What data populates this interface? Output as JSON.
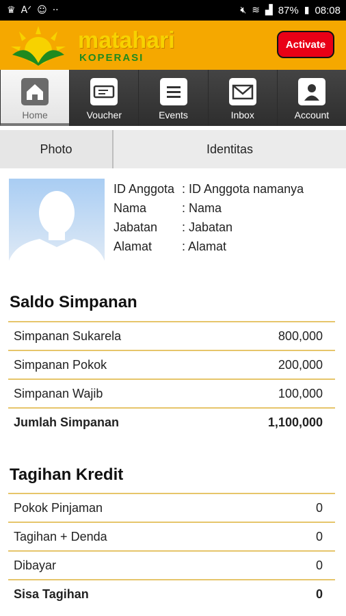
{
  "status_bar": {
    "battery": "87%",
    "time": "08:08",
    "left_icons": [
      "crown-icon",
      "font-icon",
      "cat-icon",
      "more-dots-icon"
    ],
    "right_icons": [
      "mute-icon",
      "wifi-icon",
      "signal-icon",
      "battery-icon"
    ]
  },
  "header": {
    "logo_title": "matahari",
    "logo_subtitle": "KOPERASI",
    "activate_label": "Activate",
    "colors": {
      "header_bg": "#f5a800",
      "activate_bg": "#e90016"
    }
  },
  "nav": {
    "items": [
      {
        "label": "Home",
        "icon": "home-icon",
        "active": true
      },
      {
        "label": "Voucher",
        "icon": "ticket-icon",
        "active": false
      },
      {
        "label": "Events",
        "icon": "list-icon",
        "active": false
      },
      {
        "label": "Inbox",
        "icon": "mail-icon",
        "active": false
      },
      {
        "label": "Account",
        "icon": "user-icon",
        "active": false
      }
    ]
  },
  "tabs": {
    "photo": "Photo",
    "identitas": "Identitas"
  },
  "profile": {
    "rows": [
      {
        "label": "ID Anggota",
        "value": ": ID Anggota namanya"
      },
      {
        "label": "Nama",
        "value": ": Nama"
      },
      {
        "label": "Jabatan",
        "value": ": Jabatan"
      },
      {
        "label": "Alamat",
        "value": ": Alamat"
      }
    ]
  },
  "saldo": {
    "title": "Saldo Simpanan",
    "rows": [
      {
        "label": "Simpanan Sukarela",
        "value": "800,000"
      },
      {
        "label": "Simpanan Pokok",
        "value": "200,000"
      },
      {
        "label": "Simpanan Wajib",
        "value": "100,000"
      },
      {
        "label": "Jumlah Simpanan",
        "value": "1,100,000"
      }
    ]
  },
  "tagihan": {
    "title": "Tagihan Kredit",
    "rows": [
      {
        "label": "Pokok Pinjaman",
        "value": "0"
      },
      {
        "label": "Tagihan + Denda",
        "value": "0"
      },
      {
        "label": "Dibayar",
        "value": "0"
      },
      {
        "label": "Sisa Tagihan",
        "value": "0"
      }
    ]
  }
}
